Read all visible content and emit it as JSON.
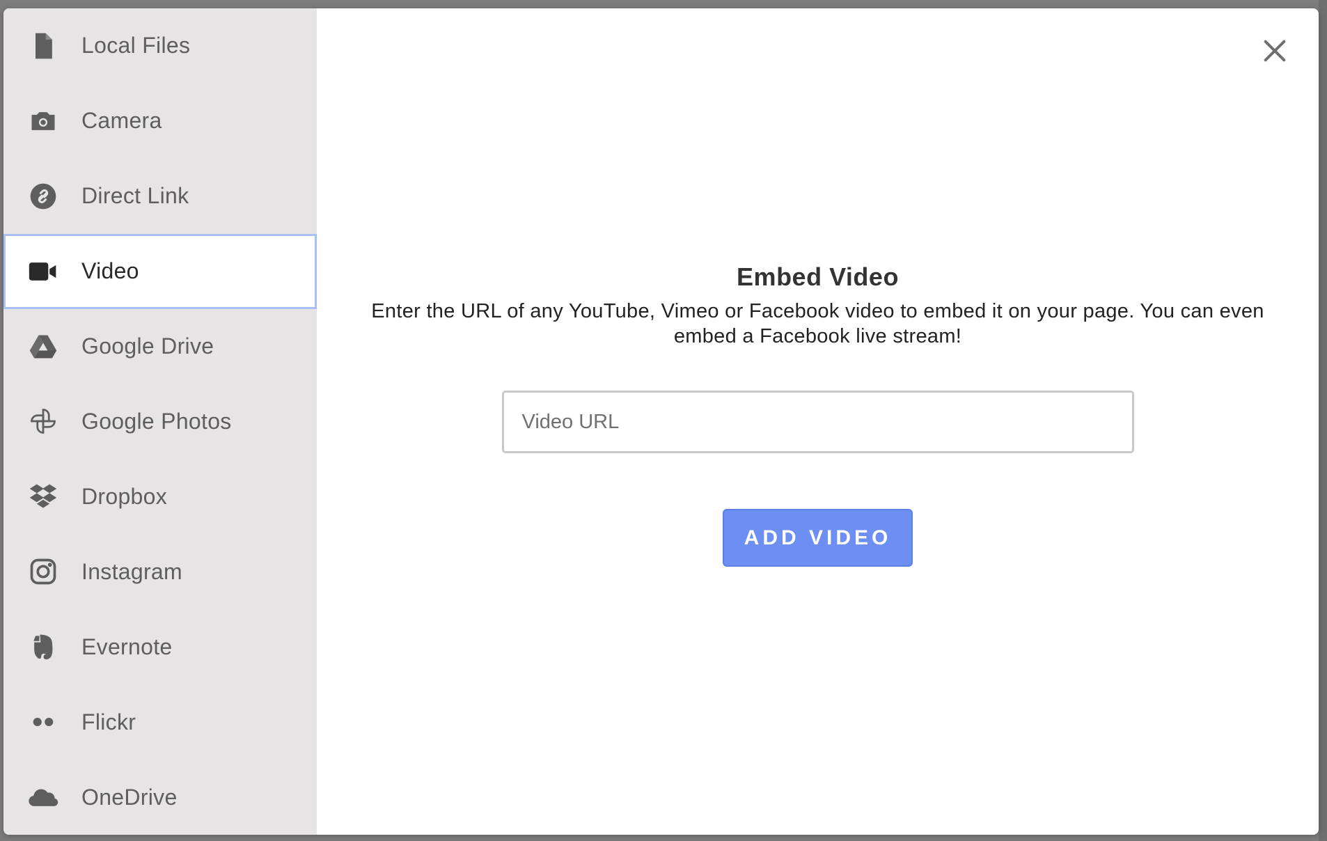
{
  "sidebar": {
    "items": [
      {
        "label": "Local Files",
        "icon": "file-icon"
      },
      {
        "label": "Camera",
        "icon": "camera-icon"
      },
      {
        "label": "Direct Link",
        "icon": "link-icon"
      },
      {
        "label": "Video",
        "icon": "video-icon",
        "active": true
      },
      {
        "label": "Google Drive",
        "icon": "google-drive-icon"
      },
      {
        "label": "Google Photos",
        "icon": "google-photos-icon"
      },
      {
        "label": "Dropbox",
        "icon": "dropbox-icon"
      },
      {
        "label": "Instagram",
        "icon": "instagram-icon"
      },
      {
        "label": "Evernote",
        "icon": "evernote-icon"
      },
      {
        "label": "Flickr",
        "icon": "flickr-icon"
      },
      {
        "label": "OneDrive",
        "icon": "onedrive-icon"
      }
    ]
  },
  "main": {
    "title": "Embed Video",
    "description": "Enter the URL of any YouTube, Vimeo or Facebook video to embed it on your page. You can even embed a Facebook live stream!",
    "input": {
      "placeholder": "Video URL",
      "value": ""
    },
    "button_label": "ADD VIDEO",
    "close_icon": "close-icon"
  },
  "colors": {
    "sidebar_bg": "#e6e4e4",
    "active_border": "#a9c0f5",
    "button_bg": "#6d8ff3",
    "icon_gray": "#5e5e5e"
  }
}
